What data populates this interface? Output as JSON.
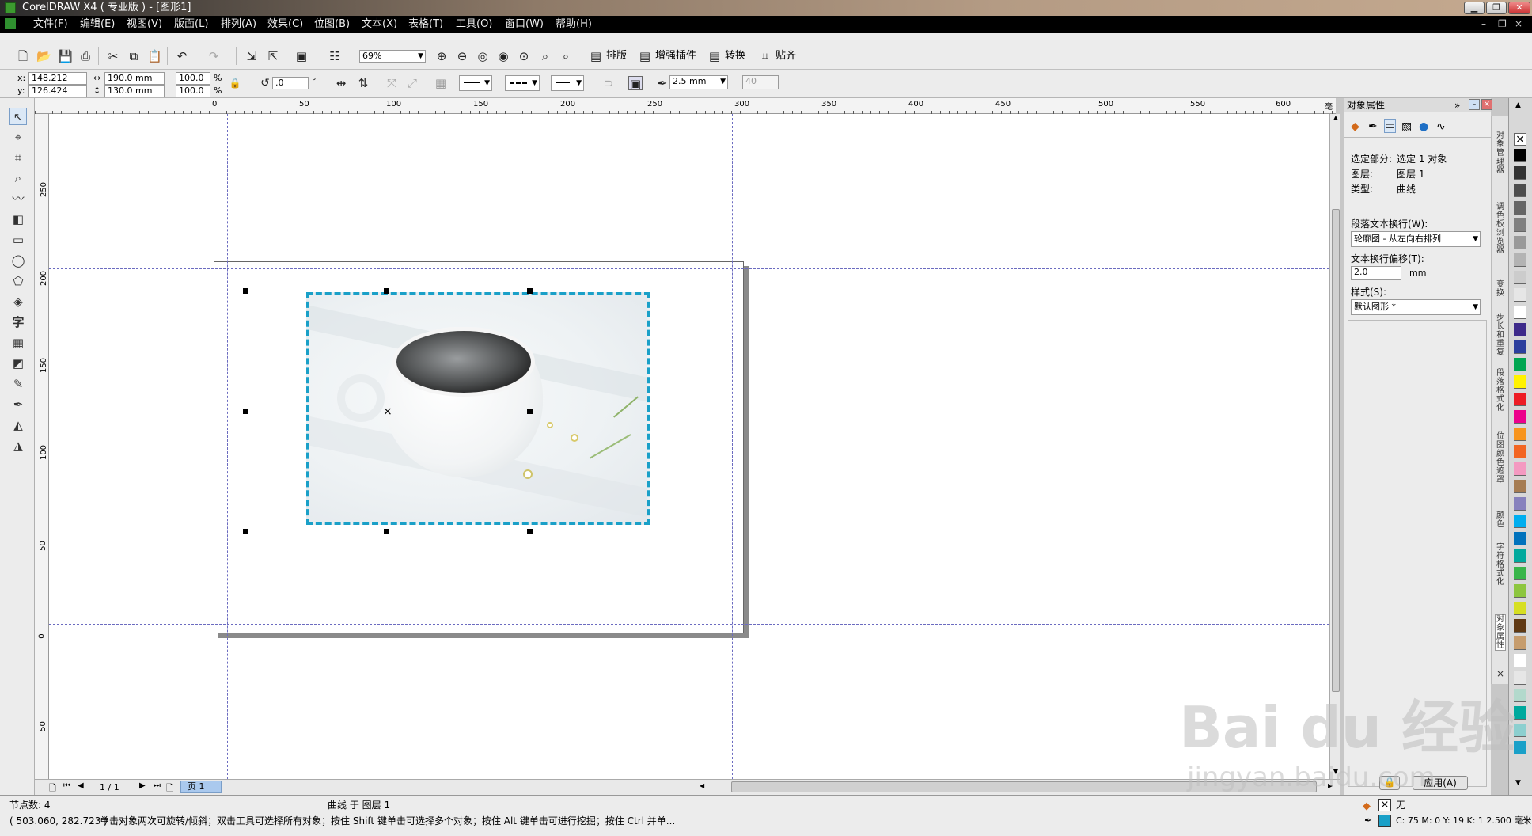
{
  "window": {
    "title": "CorelDRAW X4 ( 专业版 ) - [图形1]",
    "min": "▁",
    "max": "❐",
    "close": "✕"
  },
  "menu": [
    "文件(F)",
    "编辑(E)",
    "视图(V)",
    "版面(L)",
    "排列(A)",
    "效果(C)",
    "位图(B)",
    "文本(X)",
    "表格(T)",
    "工具(O)",
    "窗口(W)",
    "帮助(H)"
  ],
  "mdi": {
    "min": "–",
    "restore": "❐",
    "close": "×"
  },
  "toolbar": {
    "zoom": "69%",
    "layout": "排版",
    "plugins": "增强插件",
    "convert": "转换",
    "snap": "贴齐"
  },
  "propbar": {
    "x": "148.212 mm",
    "y": "126.424 mm",
    "width": "190.0 mm",
    "height": "130.0 mm",
    "scale_x": "100.0",
    "scale_y": "100.0",
    "pct": "%",
    "rotation": ".0",
    "deg": "°",
    "outline_width": "2.5 mm",
    "nudge": "40"
  },
  "hruler": {
    "ticks": [
      "0",
      "50",
      "100",
      "150",
      "200",
      "250",
      "300",
      "350",
      "400",
      "450",
      "500",
      "550",
      "600"
    ],
    "units": "毫米"
  },
  "vruler": {
    "ticks": [
      "250",
      "200",
      "150",
      "100",
      "50",
      "0",
      "50"
    ]
  },
  "docker": {
    "title": "对象属性",
    "selection_label": "选定部分:",
    "selection_value": "选定 1 对象",
    "layer_label": "图层:",
    "layer_value": "图层 1",
    "type_label": "类型:",
    "type_value": "曲线",
    "wrap_label": "段落文本换行(W):",
    "wrap_value": "轮廓图 - 从左向右排列",
    "offset_label": "文本换行偏移(T):",
    "offset_value": "2.0",
    "offset_unit": "mm",
    "style_label": "样式(S):",
    "style_value": "默认图形 *",
    "apply": "应用(A)"
  },
  "dockertabs": [
    "对象管理器",
    "调色板浏览器",
    "变换",
    "步长和重复",
    "段落格式化",
    "位图颜色遮罩",
    "颜色",
    "字符格式化",
    "对象属性"
  ],
  "palette_colors": [
    "#000000",
    "#333333",
    "#4d4d4d",
    "#666666",
    "#808080",
    "#999999",
    "#b3b3b3",
    "#cccccc",
    "#e6e6e6",
    "#ffffff",
    "#3d2a8a",
    "#2c3f9e",
    "#00a651",
    "#fff200",
    "#ed1c24",
    "#ec008c",
    "#f7941d",
    "#f26522",
    "#f49ac1",
    "#a67c52",
    "#8781bd",
    "#00aeef",
    "#0072bc",
    "#00a99d",
    "#39b54a",
    "#8dc63f",
    "#d7df23",
    "#603913",
    "#c69c6d",
    "#ffffff",
    "#e6e6e6",
    "#b3d9cc",
    "#00a99d",
    "#8ccfcf",
    "#1aa0c8"
  ],
  "pagenav": {
    "count": "1 / 1",
    "tab": "页 1"
  },
  "status": {
    "nodes": "节点数: 4",
    "object": "曲线 于 图层 1",
    "coords": "( 503.060, 282.723 )",
    "hint": "单击对象两次可旋转/倾斜；双击工具可选择所有对象；按住 Shift 键单击可选择多个对象；按住 Alt 键单击可进行挖掘；按住 Ctrl 并单...",
    "fill": "无",
    "outline": "C: 75 M: 0 Y: 19 K: 1  2.500 毫米"
  },
  "watermark": {
    "main": "Bai du 经验",
    "sub": "jingyan.baidu.com"
  }
}
